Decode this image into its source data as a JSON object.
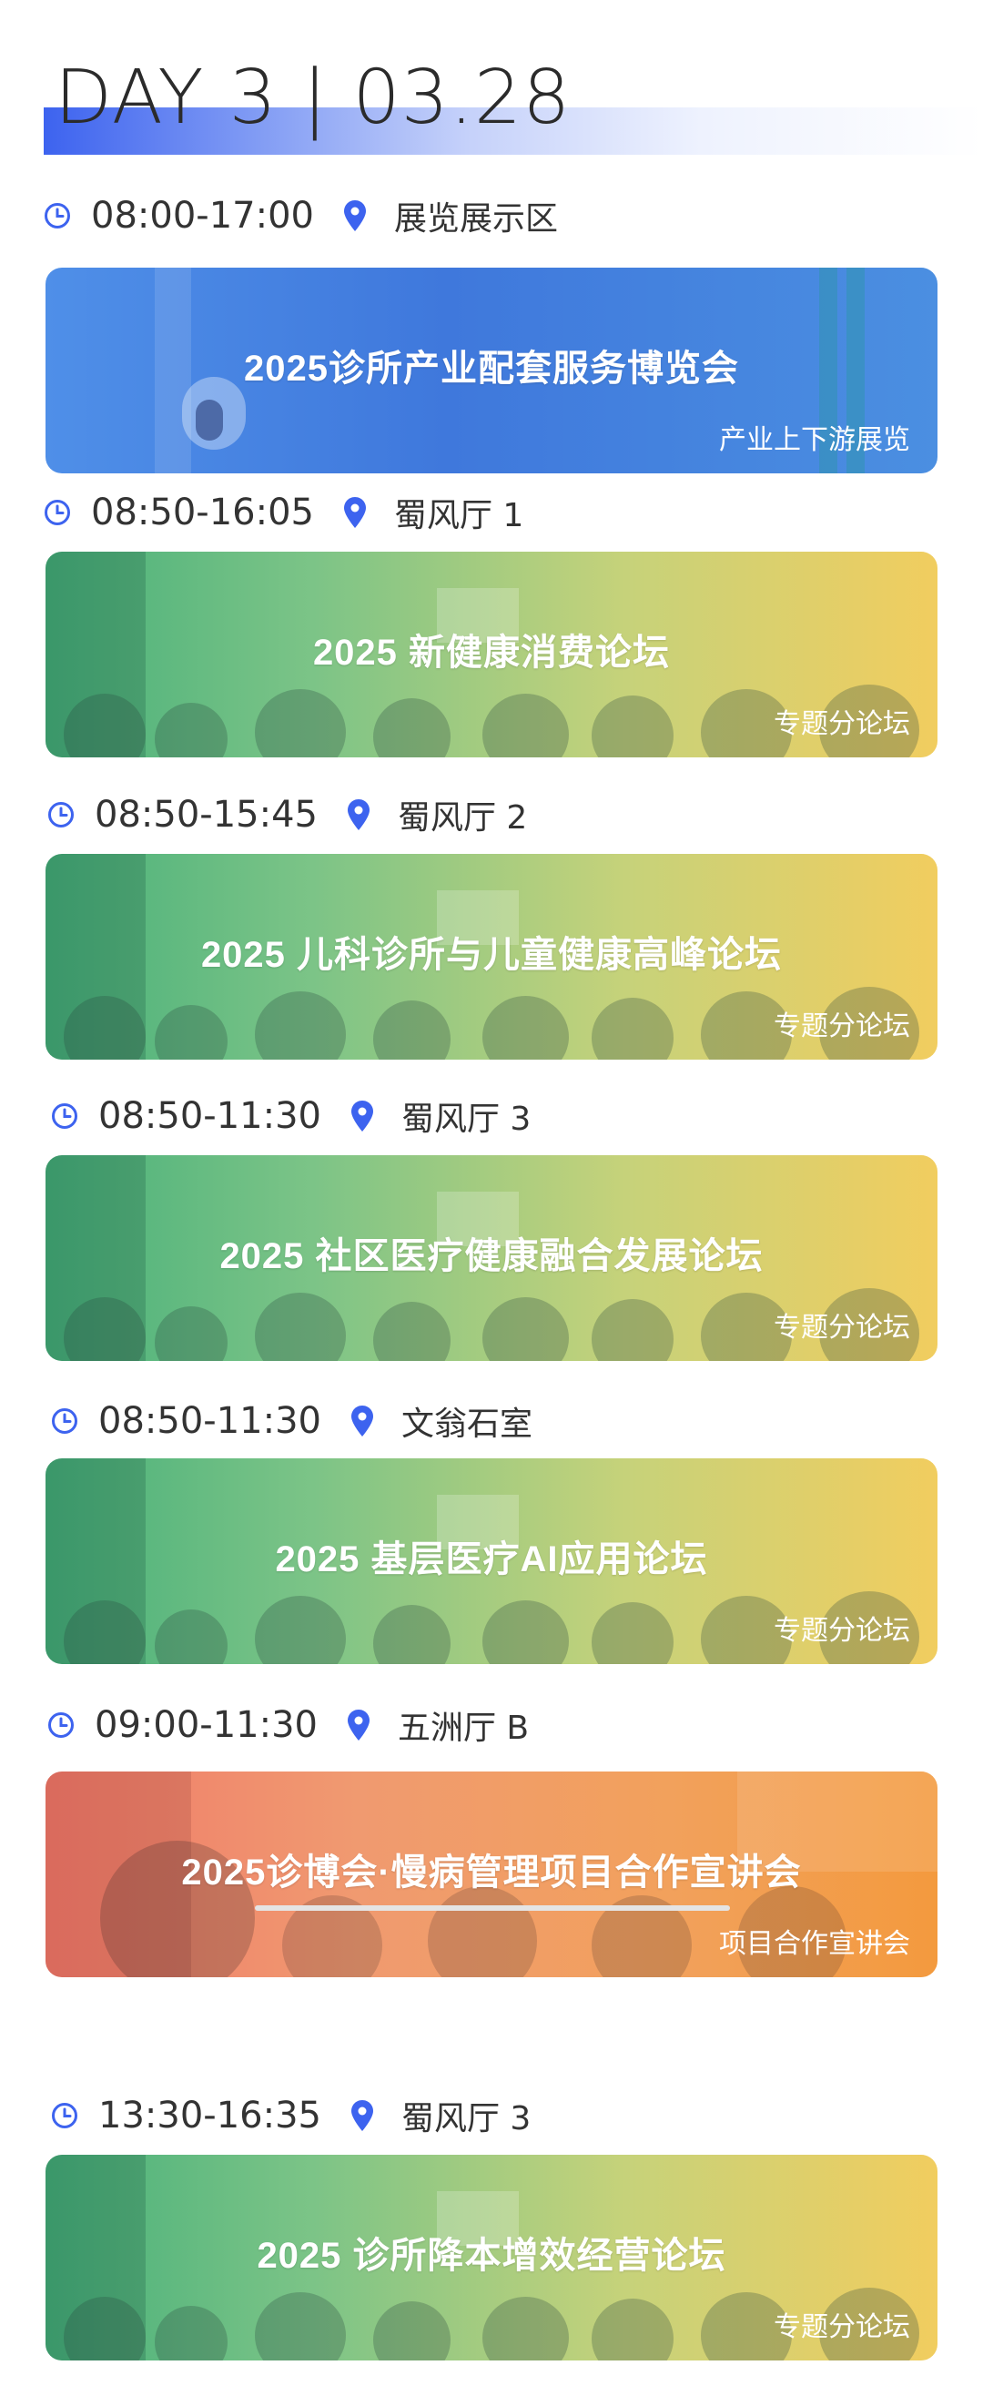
{
  "header": {
    "title": "DAY 3 | 03.28"
  },
  "colors": {
    "accent": "#3d63ef",
    "icon": "#3d63ef",
    "text": "#333333"
  },
  "icons": {
    "time": "clock-icon",
    "location": "map-pin-icon"
  },
  "sessions": [
    {
      "time": "08:00-17:00",
      "place": "展览展示区",
      "title": "2025诊所产业配套服务博览会",
      "tag": "产业上下游展览",
      "theme": "blue"
    },
    {
      "time": "08:50-16:05",
      "place": "蜀风厅 1",
      "title": "2025 新健康消费论坛",
      "tag": "专题分论坛",
      "theme": "green"
    },
    {
      "time": "08:50-15:45",
      "place": "蜀风厅 2",
      "title": "2025 儿科诊所与儿童健康高峰论坛",
      "tag": "专题分论坛",
      "theme": "green"
    },
    {
      "time": "08:50-11:30",
      "place": "蜀风厅 3",
      "title": "2025 社区医疗健康融合发展论坛",
      "tag": "专题分论坛",
      "theme": "green"
    },
    {
      "time": "08:50-11:30",
      "place": "文翁石室",
      "title": "2025 基层医疗AI应用论坛",
      "tag": "专题分论坛",
      "theme": "green"
    },
    {
      "time": "09:00-11:30",
      "place": "五洲厅 B",
      "title": "2025诊博会·慢病管理项目合作宣讲会",
      "tag": "项目合作宣讲会",
      "theme": "orange"
    },
    {
      "time": "13:30-16:35",
      "place": "蜀风厅 3",
      "title": "2025 诊所降本增效经营论坛",
      "tag": "专题分论坛",
      "theme": "green"
    }
  ]
}
